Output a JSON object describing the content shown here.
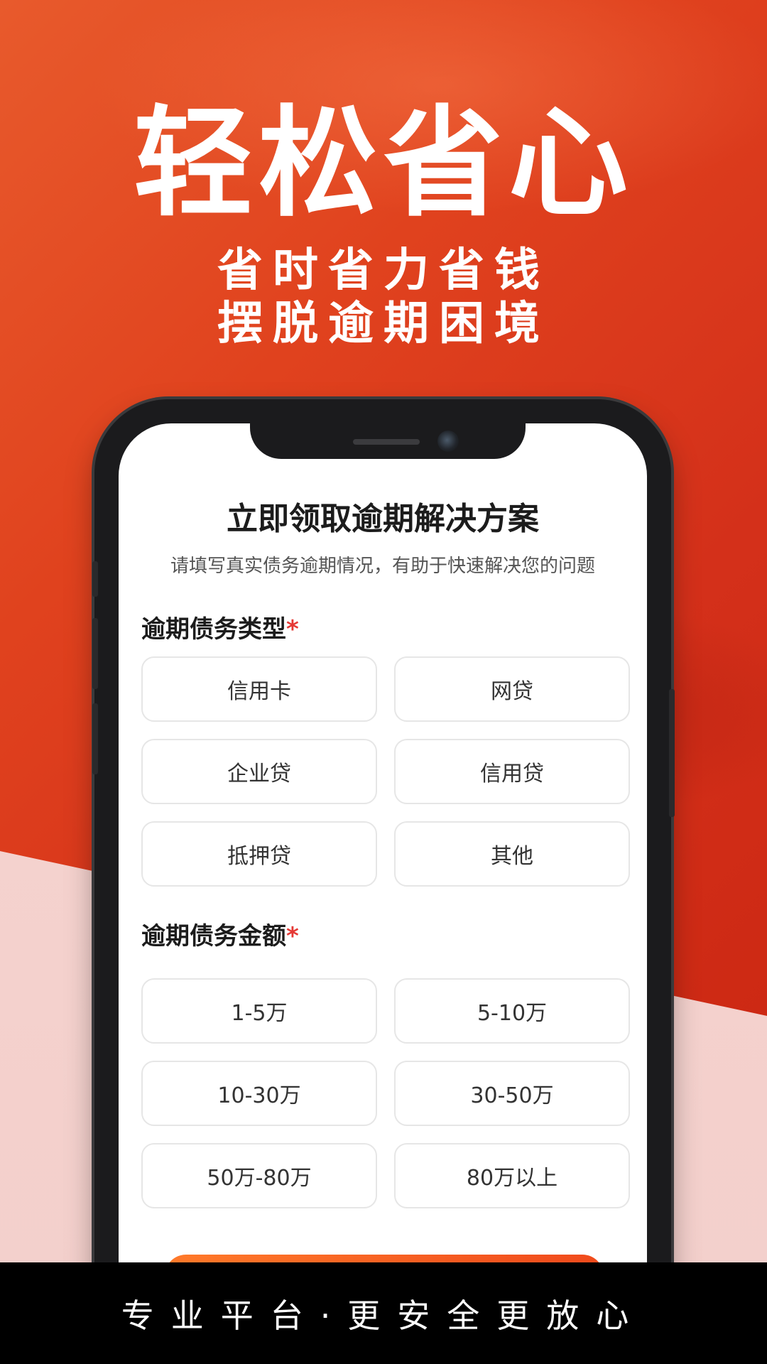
{
  "hero": {
    "title": "轻松省心",
    "subtitle_line1": "省时省力省钱",
    "subtitle_line2": "摆脱逾期困境"
  },
  "form": {
    "title": "立即领取逾期解决方案",
    "hint": "请填写真实债务逾期情况，有助于快速解决您的问题",
    "debt_type": {
      "label": "逾期债务类型",
      "required_mark": "*",
      "options": [
        "信用卡",
        "网贷",
        "企业贷",
        "信用贷",
        "抵押贷",
        "其他"
      ]
    },
    "debt_amount": {
      "label": "逾期债务金额",
      "required_mark": "*",
      "options": [
        "1-5万",
        "5-10万",
        "10-30万",
        "30-50万",
        "50万-80万",
        "80万以上"
      ]
    }
  },
  "footer": {
    "text": "专业平台·更安全更放心"
  },
  "colors": {
    "brand_red": "#d4301a",
    "required": "#e53935",
    "submit": "#f04a1c"
  }
}
